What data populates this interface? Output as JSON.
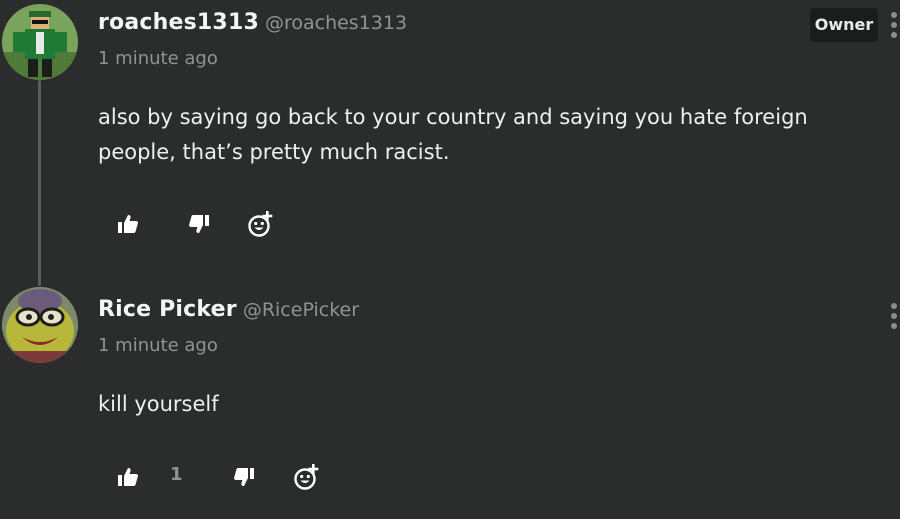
{
  "comments": [
    {
      "author": {
        "name": "roaches1313",
        "handle": "@roaches1313"
      },
      "badge": "Owner",
      "timestamp": "1 minute ago",
      "body": "also by saying go back to your country and saying you hate foreign people, that’s pretty much racist.",
      "likes": "",
      "icons": [
        "avatar-roblox",
        "thumbs-up-icon",
        "thumbs-down-icon",
        "add-reaction-icon",
        "more-vertical-icon"
      ]
    },
    {
      "author": {
        "name": "Rice Picker",
        "handle": "@RicePicker"
      },
      "timestamp": "1 minute ago",
      "body": "kill yourself",
      "likes": "1",
      "icons": [
        "avatar-cartoon",
        "thumbs-up-icon",
        "thumbs-down-icon",
        "add-reaction-icon",
        "more-vertical-icon"
      ]
    }
  ],
  "colors": {
    "background": "#2b2d2d",
    "text": "#eef0f0",
    "muted": "#8f9393",
    "badge_bg": "#1b1c1c",
    "thread_line": "#5b5e5e"
  }
}
